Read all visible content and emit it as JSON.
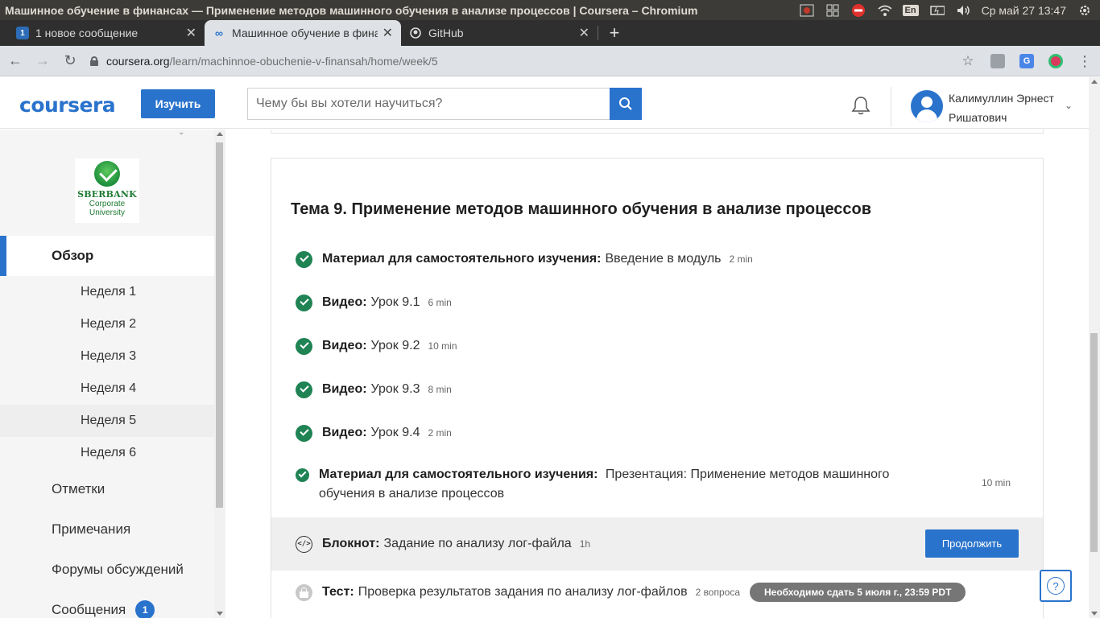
{
  "os": {
    "window_title": "Машинное обучение в финансах — Применение методов машинного обучения в анализе процессов | Coursera – Chromium",
    "keyboard_layout": "En",
    "clock": "Ср май 27 13:47"
  },
  "tabs": [
    {
      "favicon": "1",
      "title": "1 новое сообщение",
      "active": false
    },
    {
      "favicon": "coursera-icon",
      "title": "Машинное обучение в финансах",
      "active": true
    },
    {
      "favicon": "github-icon",
      "title": "GitHub",
      "active": false
    }
  ],
  "address": {
    "host": "coursera.org",
    "path": "/learn/machinnoe-obuchenie-v-finansah/home/week/5"
  },
  "header": {
    "logo": "coursera",
    "explore_label": "Изучить",
    "search_placeholder": "Чему бы вы хотели научиться?",
    "user_name": "Калимуллин Эрнест Ришатович"
  },
  "sidebar": {
    "partner_logo": {
      "name": "SBERBANK",
      "sub1": "Corporate",
      "sub2": "University"
    },
    "overview_label": "Обзор",
    "weeks": [
      "Неделя 1",
      "Неделя 2",
      "Неделя 3",
      "Неделя 4",
      "Неделя 5",
      "Неделя 6"
    ],
    "current_week_index": 4,
    "items": [
      {
        "label": "Отметки"
      },
      {
        "label": "Примечания"
      },
      {
        "label": "Форумы обсуждений"
      },
      {
        "label": "Сообщения",
        "badge": "1"
      }
    ]
  },
  "module": {
    "title": "Тема 9. Применение методов машинного обучения в анализе процессов",
    "items": [
      {
        "type": "Материал для самостоятельного изучения:",
        "name": "Введение в модуль",
        "duration": "2 min",
        "status": "completed"
      },
      {
        "type": "Видео:",
        "name": "Урок 9.1",
        "duration": "6 min",
        "status": "completed"
      },
      {
        "type": "Видео:",
        "name": "Урок 9.2",
        "duration": "10 min",
        "status": "completed"
      },
      {
        "type": "Видео:",
        "name": "Урок 9.3",
        "duration": "8 min",
        "status": "completed"
      },
      {
        "type": "Видео:",
        "name": "Урок 9.4",
        "duration": "2 min",
        "status": "completed"
      },
      {
        "type": "Материал для самостоятельного изучения:",
        "name": "Презентация: Применение методов машинного обучения в анализе процессов",
        "duration": "10 min",
        "status": "completed"
      },
      {
        "type": "Блокнот:",
        "name": "Задание по анализу лог-файла",
        "duration": "1h",
        "status": "in-progress",
        "action": "Продолжить"
      },
      {
        "type": "Тест:",
        "name": "Проверка результатов задания по анализу лог-файлов",
        "duration": "2 вопроса",
        "status": "locked",
        "due": "Необходимо сдать 5 июля г., 23:59 PDT"
      }
    ]
  },
  "help": {
    "label": "?"
  },
  "colors": {
    "accent": "#2a73cc",
    "completed": "#1f8354",
    "due_pill": "#767676"
  }
}
